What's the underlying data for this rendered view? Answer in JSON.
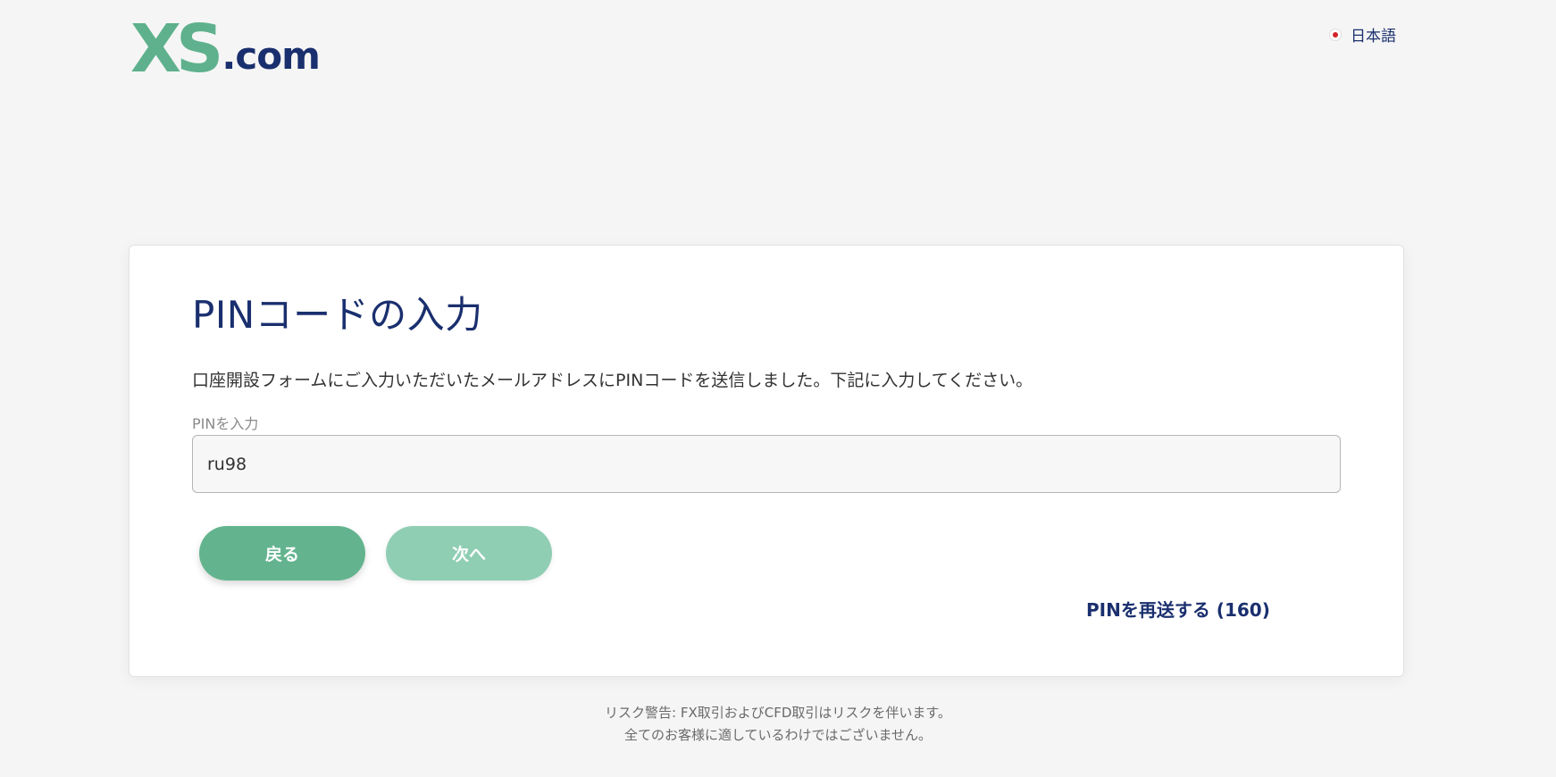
{
  "header": {
    "logo_primary": "XS",
    "logo_suffix": ".com",
    "language": "日本語",
    "language_flag_icon": "japan-flag-icon"
  },
  "card": {
    "title": "PINコードの入力",
    "description": "口座開設フォームにご入力いただいたメールアドレスにPINコードを送信しました。下記に入力してください。",
    "pin_label": "PINを入力",
    "pin_value": "ru98",
    "back_label": "戻る",
    "next_label": "次へ",
    "resend_label": "PINを再送する (160)"
  },
  "footer": {
    "line1": "リスク警告: FX取引およびCFD取引はリスクを伴います。",
    "line2": "全てのお客様に適しているわけではございません。"
  },
  "colors": {
    "brand_green": "#5eb18c",
    "brand_navy": "#1a2f6e",
    "button_primary": "#63b48e",
    "button_disabled": "#90ceb4"
  }
}
